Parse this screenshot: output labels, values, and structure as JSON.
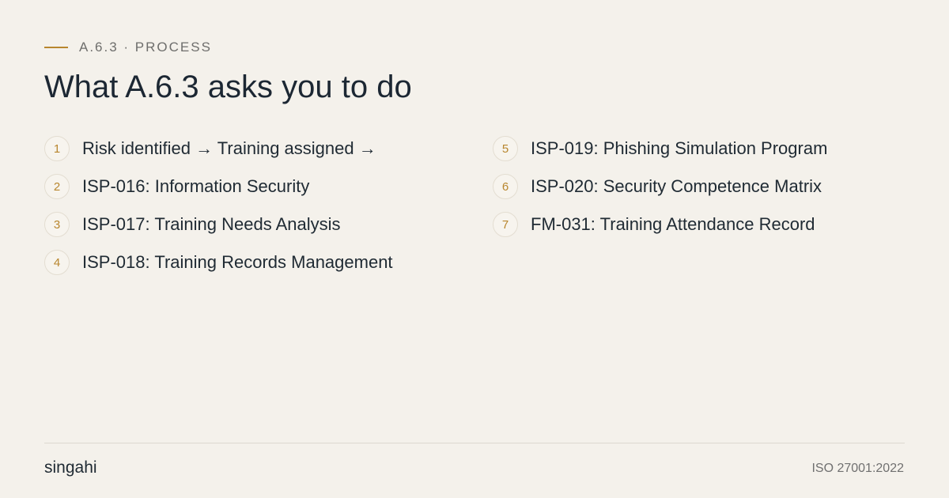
{
  "eyebrow": "A.6.3 · PROCESS",
  "title": "What A.6.3 asks you to do",
  "steps": [
    {
      "number": "1",
      "text": "Risk identified → Training assigned →"
    },
    {
      "number": "2",
      "text": "ISP-016: Information Security"
    },
    {
      "number": "3",
      "text": "ISP-017: Training Needs Analysis"
    },
    {
      "number": "4",
      "text": "ISP-018: Training Records Management"
    },
    {
      "number": "5",
      "text": "ISP-019: Phishing Simulation Program"
    },
    {
      "number": "6",
      "text": "ISP-020: Security Competence Matrix"
    },
    {
      "number": "7",
      "text": "FM-031: Training Attendance Record"
    }
  ],
  "footer": {
    "brand": "singahi",
    "standard": "ISO 27001:2022"
  },
  "colors": {
    "background": "#f4f1eb",
    "accent": "#b8862e",
    "text": "#1f2a33",
    "muted": "#6e6e6c"
  }
}
